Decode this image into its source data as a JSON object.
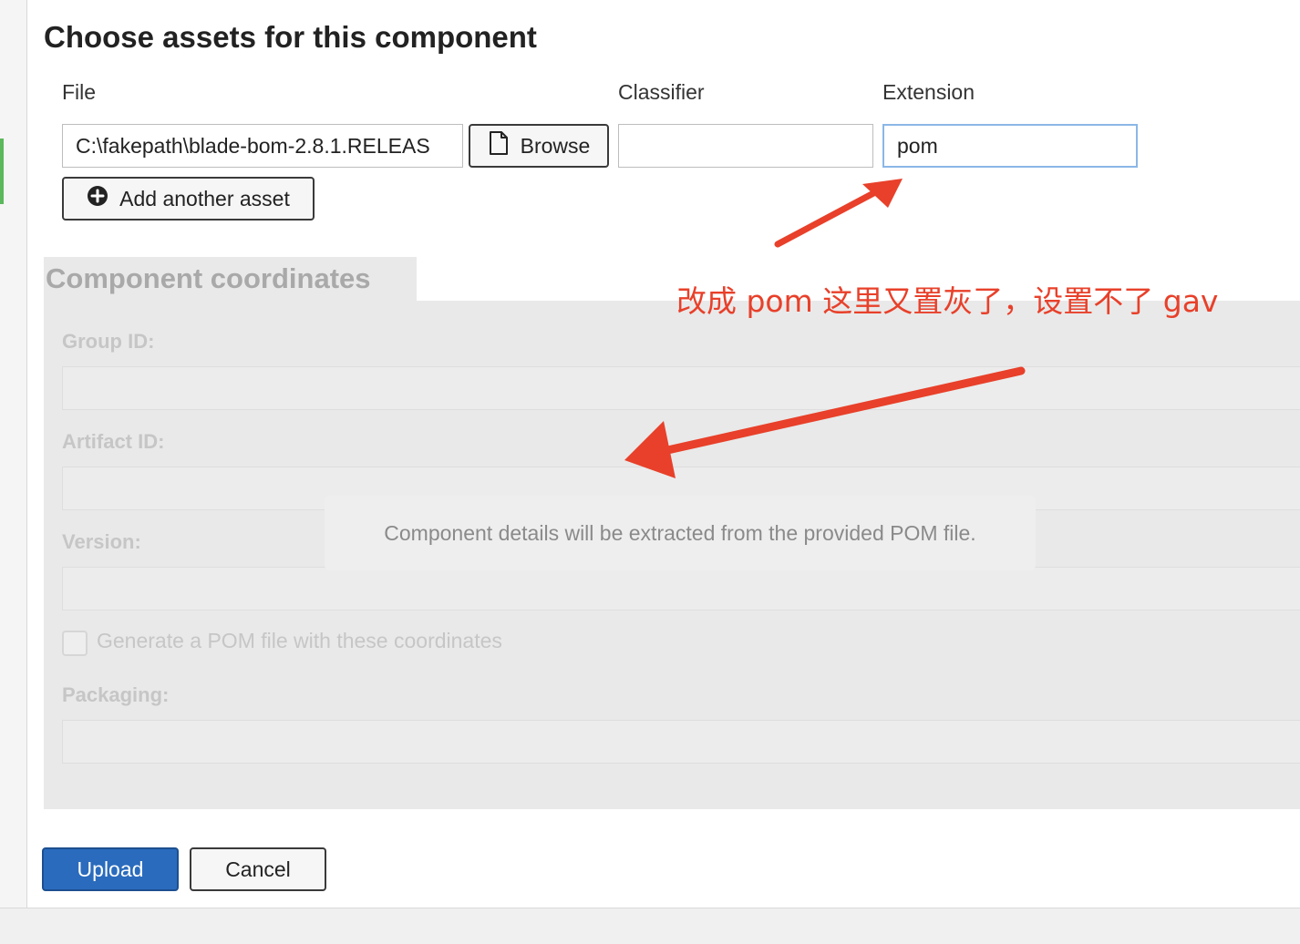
{
  "page": {
    "title": "Choose assets for this component"
  },
  "assets": {
    "file_label": "File",
    "classifier_label": "Classifier",
    "extension_label": "Extension",
    "file_value": "C:\\fakepath\\blade-bom-2.8.1.RELEAS",
    "browse_label": "Browse",
    "classifier_value": "",
    "extension_value": "pom",
    "add_asset_label": "Add another asset"
  },
  "coordinates": {
    "header": "Component coordinates",
    "group_id_label": "Group ID:",
    "artifact_id_label": "Artifact ID:",
    "version_label": "Version:",
    "generate_pom_label": "Generate a POM file with these coordinates",
    "packaging_label": "Packaging:",
    "pom_message": "Component details will be extracted from the provided POM file."
  },
  "actions": {
    "upload_label": "Upload",
    "cancel_label": "Cancel"
  },
  "annotation": {
    "text": "改成 pom 这里又置灰了，设置不了 gav",
    "color": "#e8402a"
  },
  "colors": {
    "primary": "#2a6bbd",
    "disabled_panel": "#e9e9e9",
    "left_accent": "#5cb85c",
    "focus_border": "#8bb7e6"
  },
  "icons": {
    "browse": "file-icon",
    "add_asset": "plus-circle-icon"
  }
}
